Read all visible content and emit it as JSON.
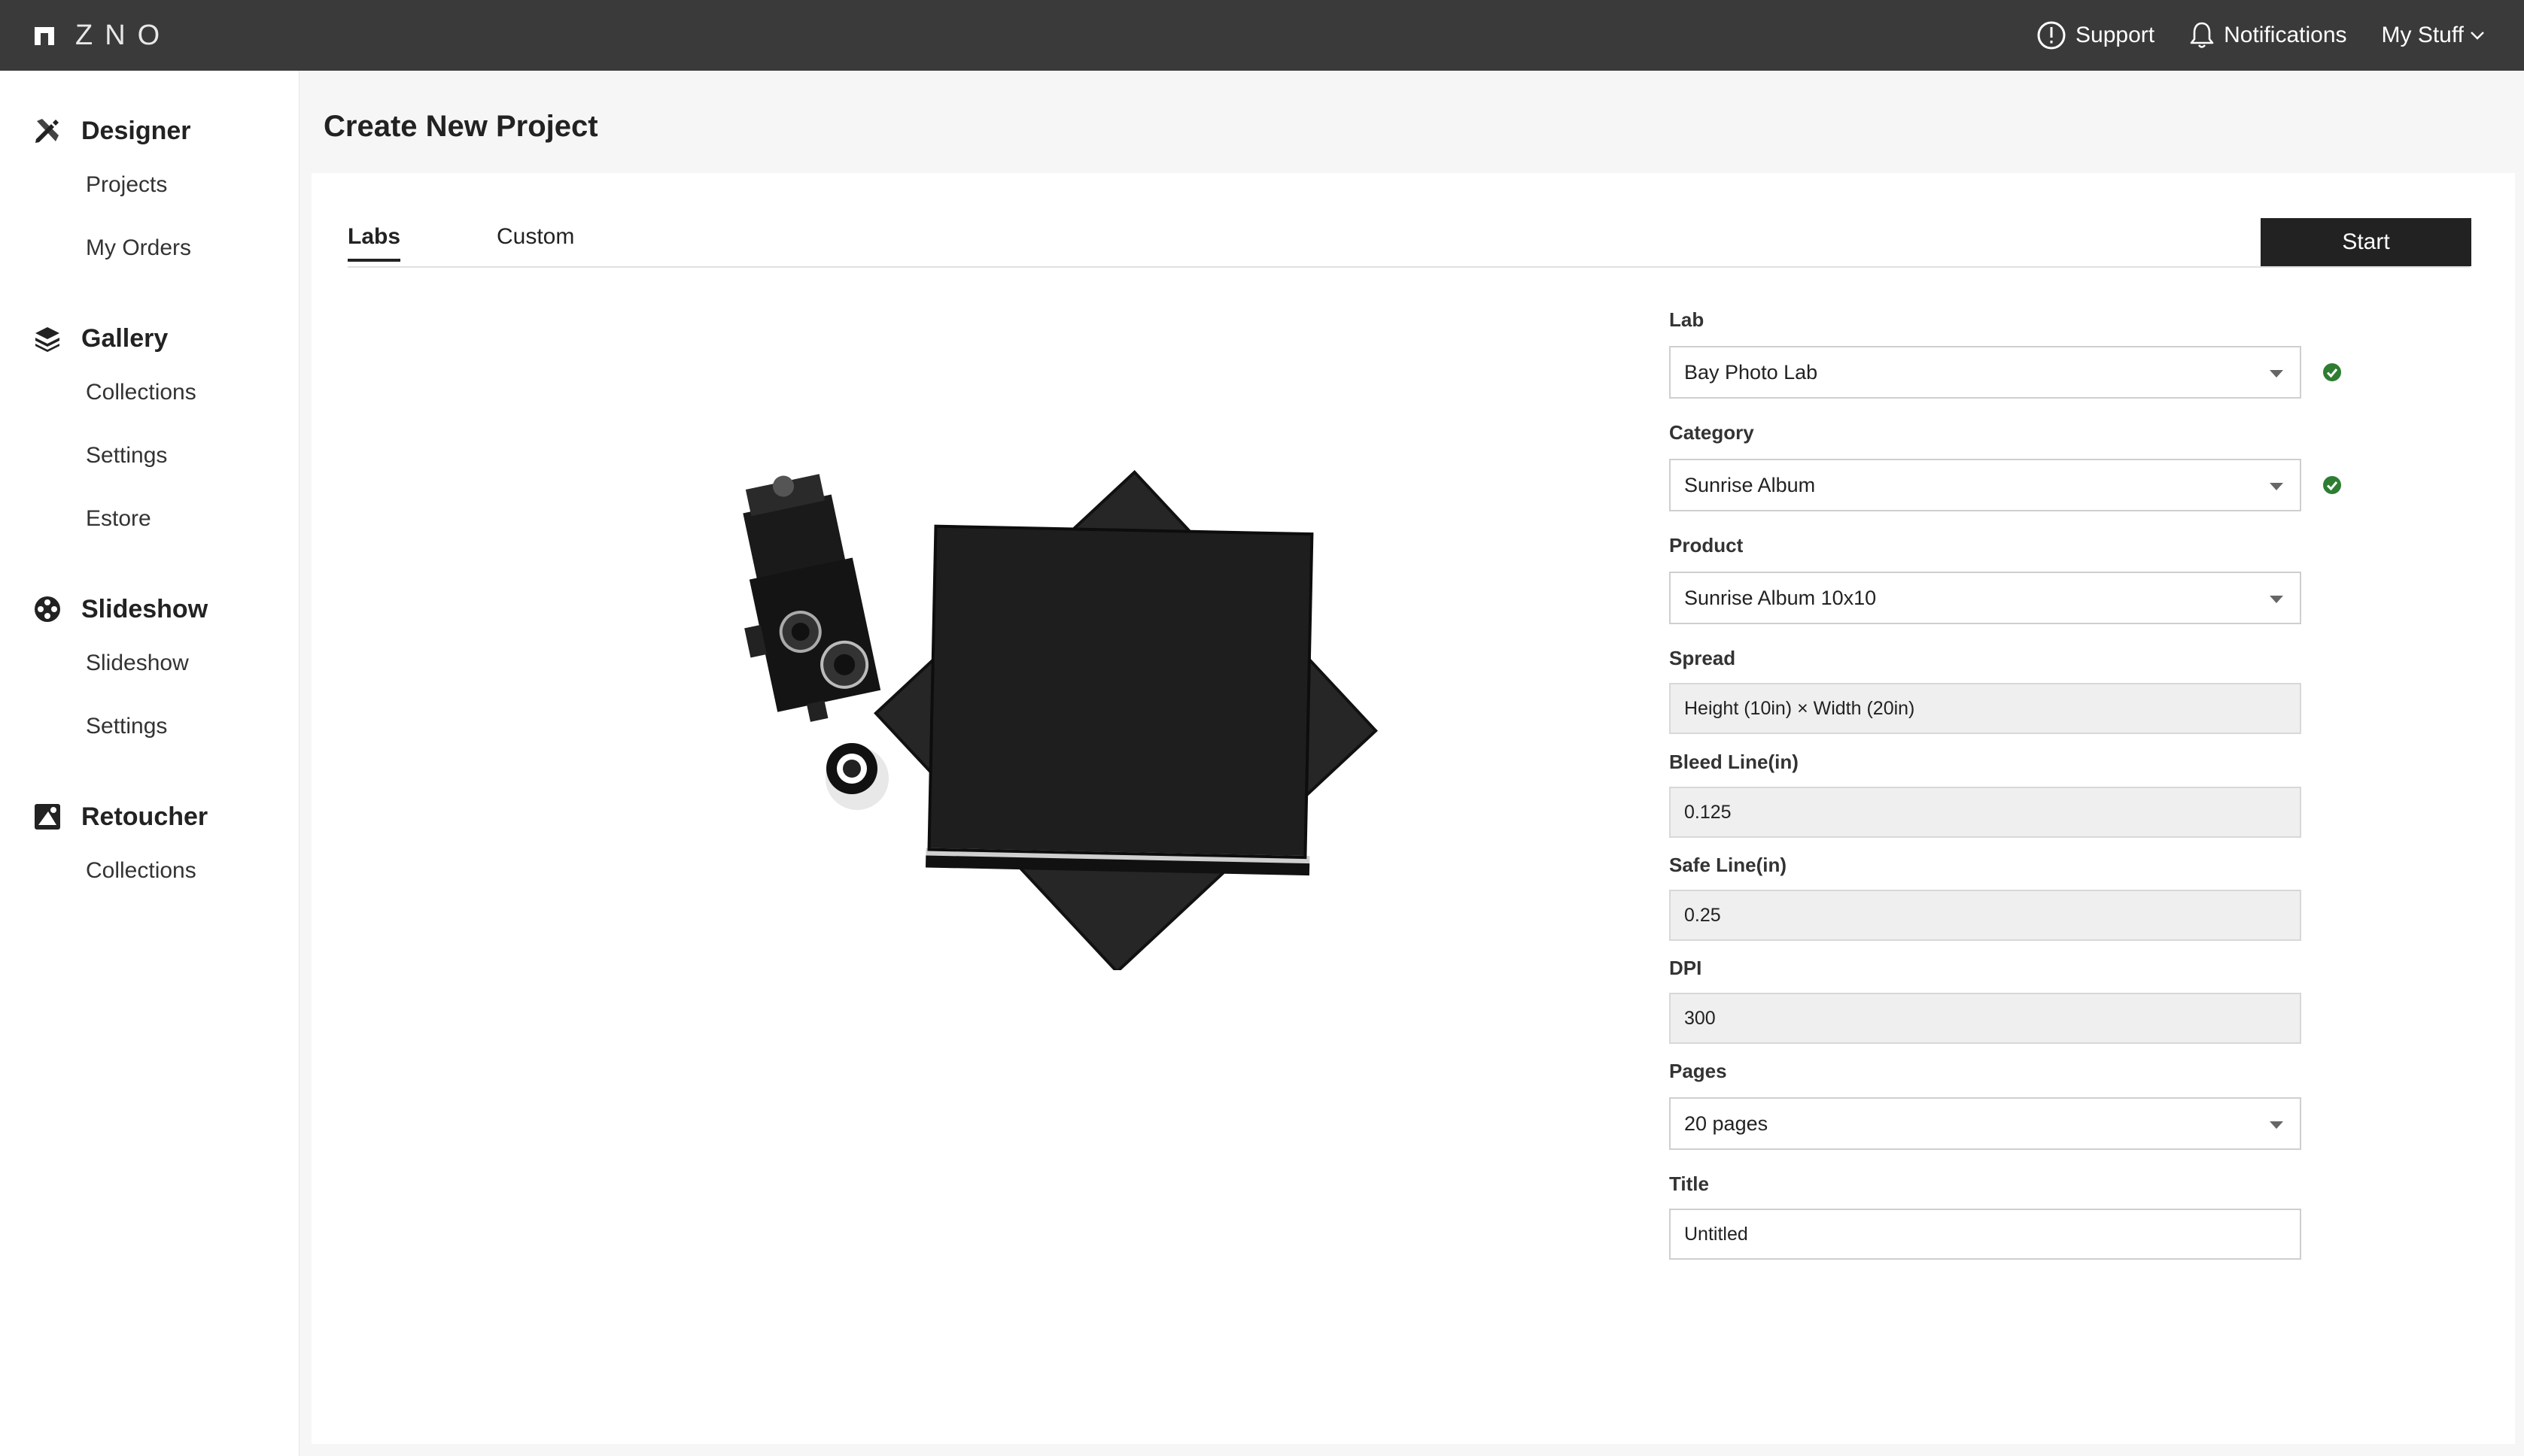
{
  "topbar": {
    "logo_text": "ZNO",
    "support_label": "Support",
    "notifications_label": "Notifications",
    "mystuff_label": "My Stuff"
  },
  "sidebar": {
    "sections": [
      {
        "title": "Designer",
        "icon": "designer-icon",
        "items": [
          "Projects",
          "My Orders"
        ]
      },
      {
        "title": "Gallery",
        "icon": "gallery-layers-icon",
        "items": [
          "Collections",
          "Settings",
          "Estore"
        ]
      },
      {
        "title": "Slideshow",
        "icon": "film-reel-icon",
        "items": [
          "Slideshow",
          "Settings"
        ]
      },
      {
        "title": "Retoucher",
        "icon": "retoucher-icon",
        "items": [
          "Collections"
        ]
      }
    ]
  },
  "main": {
    "page_title": "Create New Project",
    "tabs": [
      {
        "label": "Labs",
        "active": true
      },
      {
        "label": "Custom",
        "active": false
      }
    ],
    "start_label": "Start"
  },
  "form": {
    "lab": {
      "label": "Lab",
      "value": "Bay Photo Lab",
      "valid": true
    },
    "category": {
      "label": "Category",
      "value": "Sunrise Album",
      "valid": true
    },
    "product": {
      "label": "Product",
      "value": "Sunrise Album 10x10"
    },
    "spread": {
      "label": "Spread",
      "value": "Height (10in) × Width (20in)"
    },
    "bleed": {
      "label": "Bleed Line(in)",
      "value": "0.125"
    },
    "safe": {
      "label": "Safe Line(in)",
      "value": "0.25"
    },
    "dpi": {
      "label": "DPI",
      "value": "300"
    },
    "pages": {
      "label": "Pages",
      "value": "20 pages"
    },
    "title": {
      "label": "Title",
      "value": "Untitled"
    }
  },
  "colors": {
    "topbar": "#3a3a3a",
    "accent_dark": "#222222",
    "valid_green": "#2e7d32",
    "readonly_bg": "#efefef"
  }
}
